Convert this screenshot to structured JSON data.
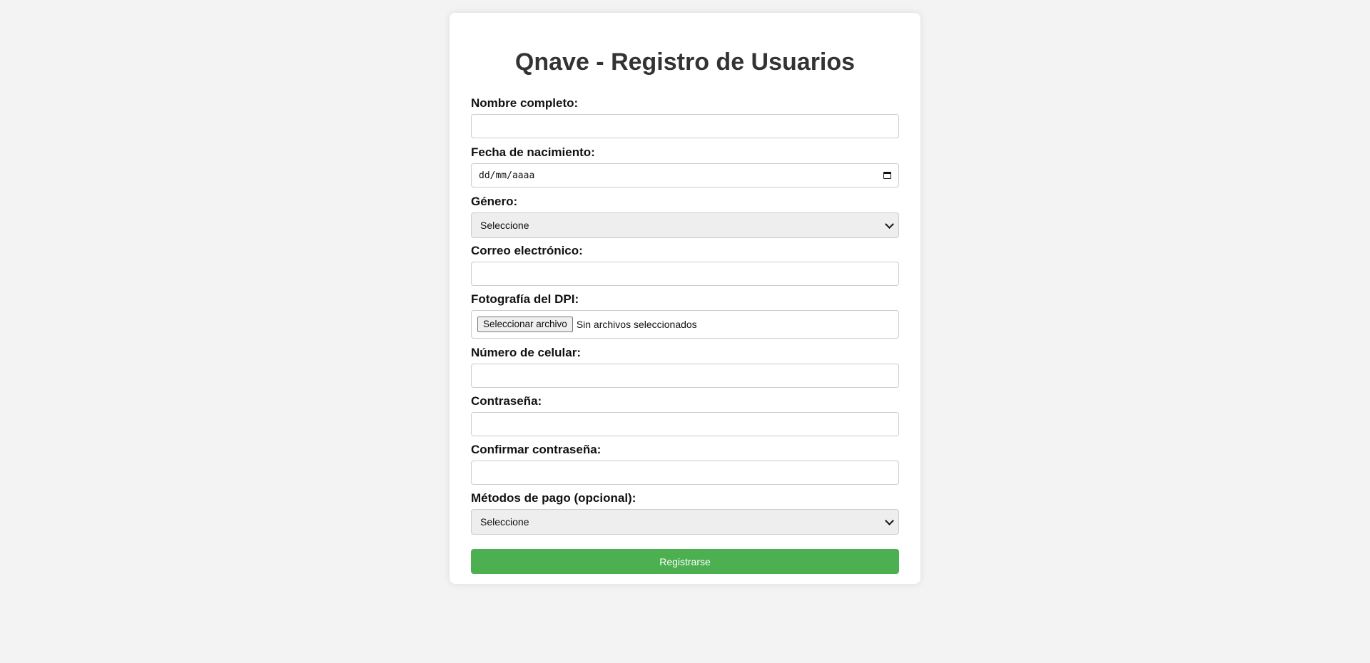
{
  "form": {
    "title": "Qnave - Registro de Usuarios",
    "accent_color": "#4caf50",
    "fields": {
      "nombre": {
        "label": "Nombre completo:",
        "value": ""
      },
      "fecha": {
        "label": "Fecha de nacimiento:",
        "placeholder": "dd/mm/aaaa",
        "icon": "calendar-icon"
      },
      "genero": {
        "label": "Género:",
        "selected": "Seleccione",
        "icon": "chevron-down-icon"
      },
      "correo": {
        "label": "Correo electrónico:",
        "value": ""
      },
      "dpi": {
        "label": "Fotografía del DPI:",
        "button_label": "Seleccionar archivo",
        "status": "Sin archivos seleccionados"
      },
      "celular": {
        "label": "Número de celular:",
        "value": ""
      },
      "contrasena": {
        "label": "Contraseña:",
        "value": ""
      },
      "confirmar": {
        "label": "Confirmar contraseña:",
        "value": ""
      },
      "pago": {
        "label": "Métodos de pago (opcional):",
        "selected": "Seleccione",
        "icon": "chevron-down-icon"
      }
    },
    "submit_label": "Registrarse"
  }
}
